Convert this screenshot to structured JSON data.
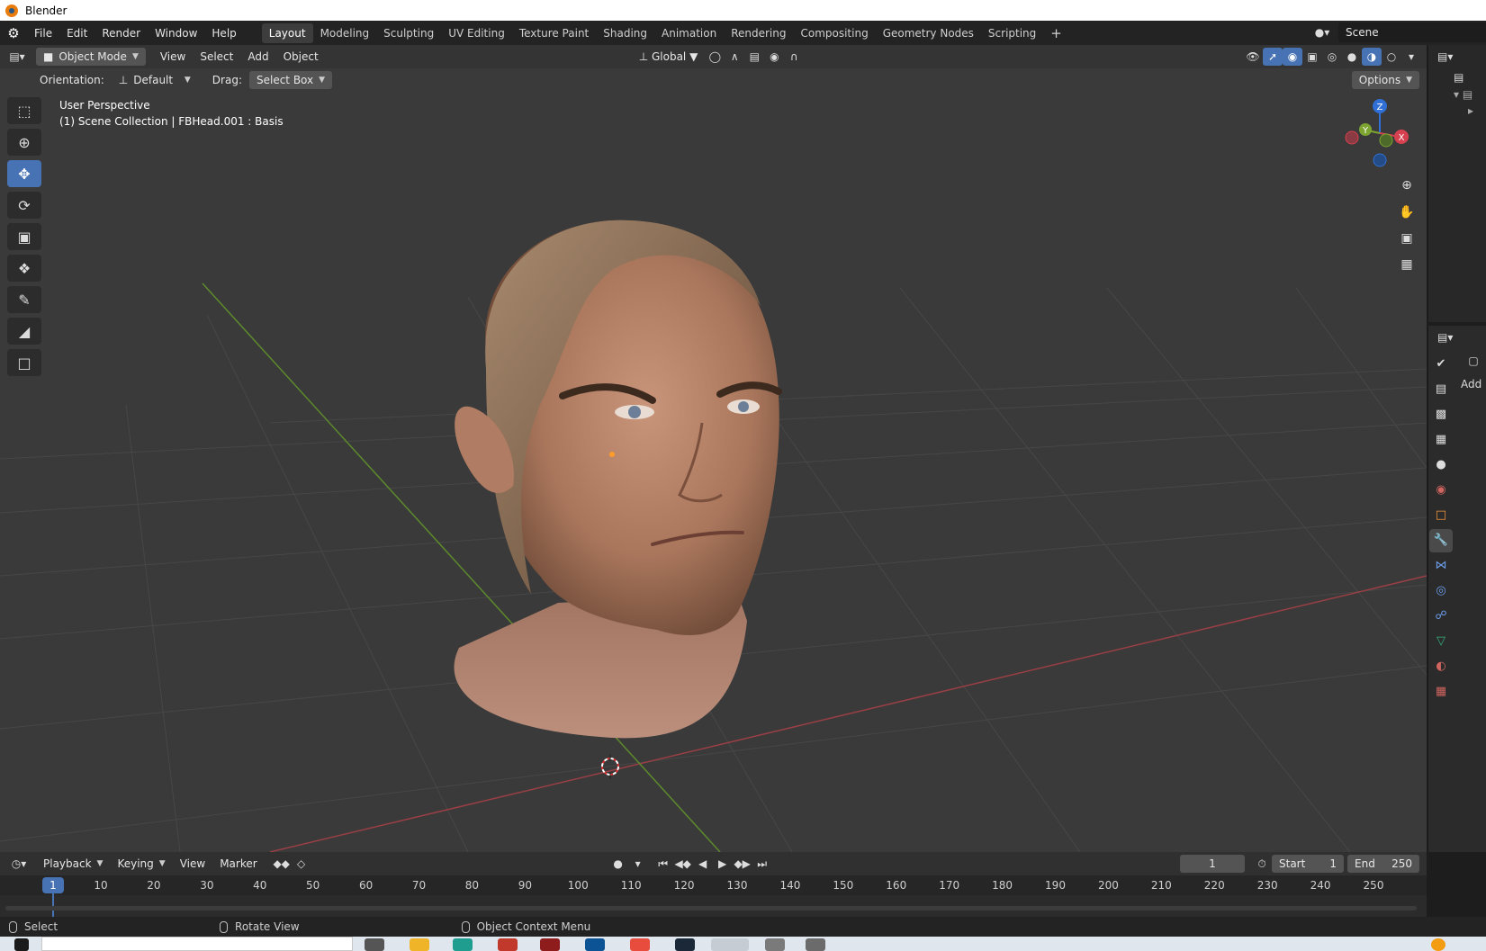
{
  "window": {
    "title": "Blender"
  },
  "menubar": {
    "file": "File",
    "edit": "Edit",
    "render": "Render",
    "window": "Window",
    "help": "Help",
    "workspaces": [
      "Layout",
      "Modeling",
      "Sculpting",
      "UV Editing",
      "Texture Paint",
      "Shading",
      "Animation",
      "Rendering",
      "Compositing",
      "Geometry Nodes",
      "Scripting"
    ],
    "active_workspace": "Layout",
    "add_tab_icon": "plus-icon",
    "scene": "Scene"
  },
  "viewport_header": {
    "mode": "Object Mode",
    "view": "View",
    "select": "Select",
    "add": "Add",
    "object": "Object",
    "transform_orientation": "Global"
  },
  "tool_header": {
    "orientation_label": "Orientation:",
    "orientation_value": "Default",
    "drag_label": "Drag:",
    "drag_value": "Select Box",
    "options": "Options"
  },
  "viewport_info": {
    "perspective": "User Perspective",
    "collection": "(1) Scene Collection | FBHead.001 : Basis"
  },
  "gizmo": {
    "z": "Z",
    "y": "Y",
    "x": "X"
  },
  "colors": {
    "accent": "#4772b3",
    "x_axis": "#d6414f",
    "y_axis": "#7da331",
    "z_axis": "#2f6fd6",
    "viewport_bg": "#3a3a3a"
  },
  "timeline": {
    "playback": "Playback",
    "keying": "Keying",
    "view": "View",
    "marker": "Marker",
    "current_frame": "1",
    "start_label": "Start",
    "start_value": "1",
    "end_label": "End",
    "end_value": "250",
    "playhead": "1",
    "ticks": [
      "10",
      "20",
      "30",
      "40",
      "50",
      "60",
      "70",
      "80",
      "90",
      "100",
      "110",
      "120",
      "130",
      "140",
      "150",
      "160",
      "170",
      "180",
      "190",
      "200",
      "210",
      "220",
      "230",
      "240",
      "250"
    ]
  },
  "statusbar": {
    "select": "Select",
    "rotate": "Rotate View",
    "context": "Object Context Menu"
  },
  "properties": {
    "add_label": "Add"
  }
}
